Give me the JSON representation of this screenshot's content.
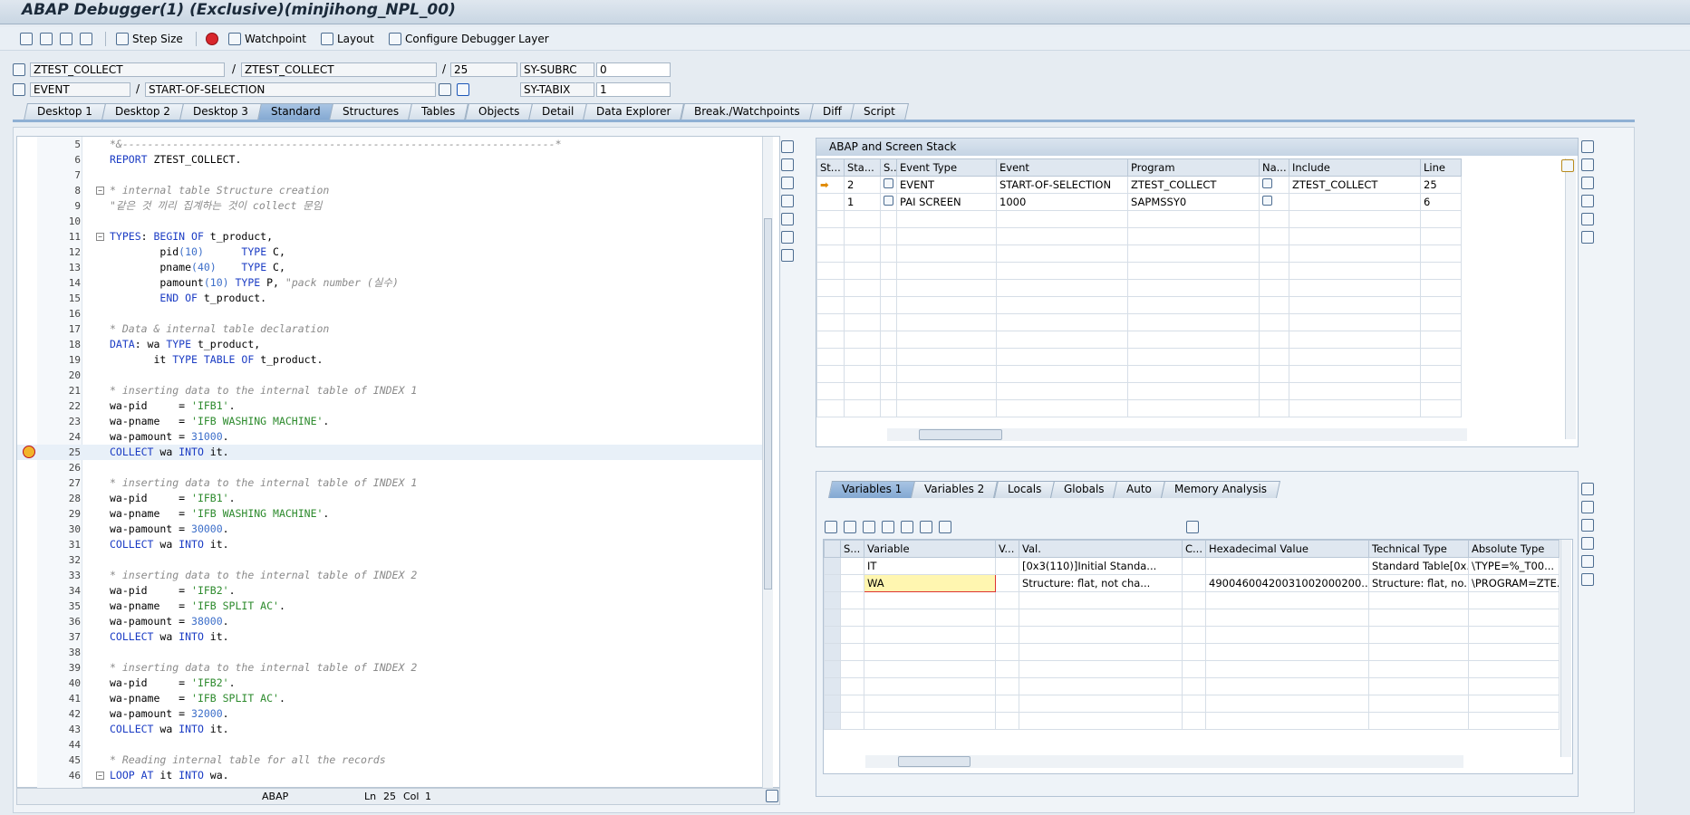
{
  "window": {
    "title": "ABAP Debugger(1)  (Exclusive)(minjihong_NPL_00)"
  },
  "toolbar": {
    "step_size": "Step Size",
    "watchpoint": "Watchpoint",
    "layout": "Layout",
    "configure": "Configure Debugger Layer"
  },
  "info": {
    "program": "ZTEST_COLLECT",
    "include": "ZTEST_COLLECT",
    "line": "25",
    "sy_subrc_label": "SY-SUBRC",
    "sy_subrc_value": "0",
    "event_type": "EVENT",
    "event": "START-OF-SELECTION",
    "sy_tabix_label": "SY-TABIX",
    "sy_tabix_value": "1"
  },
  "tabs": [
    "Desktop 1",
    "Desktop 2",
    "Desktop 3",
    "Standard",
    "Structures",
    "Tables",
    "Objects",
    "Detail",
    "Data Explorer",
    "Break./Watchpoints",
    "Diff",
    "Script"
  ],
  "editor": {
    "lines": [
      {
        "n": "5",
        "html": "<span class=\"c\">*&amp;---------------------------------------------------------------------*</span>"
      },
      {
        "n": "6",
        "html": "<span class=\"k\">REPORT</span> ZTEST_COLLECT."
      },
      {
        "n": "7",
        "html": ""
      },
      {
        "n": "8",
        "html": "<span class=\"c\">* internal table Structure creation</span>"
      },
      {
        "n": "9",
        "html": "<span class=\"c\">\"같은 것 끼리 집계하는 것이 collect 문임</span>"
      },
      {
        "n": "10",
        "html": ""
      },
      {
        "n": "11",
        "html": "<span class=\"k\">TYPES</span>: <span class=\"k\">BEGIN OF</span> t_product,"
      },
      {
        "n": "12",
        "html": "        pid<span class=\"num\">(10)</span>      <span class=\"k\">TYPE</span> C,"
      },
      {
        "n": "13",
        "html": "        pname<span class=\"num\">(40)</span>    <span class=\"k\">TYPE</span> C,"
      },
      {
        "n": "14",
        "html": "        pamount<span class=\"num\">(10)</span> <span class=\"k\">TYPE</span> P, <span class=\"c\">\"pack number (실수)</span>"
      },
      {
        "n": "15",
        "html": "        <span class=\"k\">END OF</span> t_product."
      },
      {
        "n": "16",
        "html": ""
      },
      {
        "n": "17",
        "html": "<span class=\"c\">* Data &amp; internal table declaration</span>"
      },
      {
        "n": "18",
        "html": "<span class=\"k\">DATA</span>: wa <span class=\"k\">TYPE</span> t_product,"
      },
      {
        "n": "19",
        "html": "       it <span class=\"k\">TYPE TABLE OF</span> t_product."
      },
      {
        "n": "20",
        "html": ""
      },
      {
        "n": "21",
        "html": "<span class=\"c\">* inserting data to the internal table of INDEX 1</span>"
      },
      {
        "n": "22",
        "html": "wa-pid     = <span class=\"s\">'IFB1'</span>."
      },
      {
        "n": "23",
        "html": "wa-pname   = <span class=\"s\">'IFB WASHING MACHINE'</span>."
      },
      {
        "n": "24",
        "html": "wa-pamount = <span class=\"num\">31000</span>."
      },
      {
        "n": "25",
        "html": "<span class=\"k\">COLLECT</span> wa <span class=\"k\">INTO</span> it."
      },
      {
        "n": "26",
        "html": ""
      },
      {
        "n": "27",
        "html": "<span class=\"c\">* inserting data to the internal table of INDEX 1</span>"
      },
      {
        "n": "28",
        "html": "wa-pid     = <span class=\"s\">'IFB1'</span>."
      },
      {
        "n": "29",
        "html": "wa-pname   = <span class=\"s\">'IFB WASHING MACHINE'</span>."
      },
      {
        "n": "30",
        "html": "wa-pamount = <span class=\"num\">30000</span>."
      },
      {
        "n": "31",
        "html": "<span class=\"k\">COLLECT</span> wa <span class=\"k\">INTO</span> it."
      },
      {
        "n": "32",
        "html": ""
      },
      {
        "n": "33",
        "html": "<span class=\"c\">* inserting data to the internal table of INDEX 2</span>"
      },
      {
        "n": "34",
        "html": "wa-pid     = <span class=\"s\">'IFB2'</span>."
      },
      {
        "n": "35",
        "html": "wa-pname   = <span class=\"s\">'IFB SPLIT AC'</span>."
      },
      {
        "n": "36",
        "html": "wa-pamount = <span class=\"num\">38000</span>."
      },
      {
        "n": "37",
        "html": "<span class=\"k\">COLLECT</span> wa <span class=\"k\">INTO</span> it."
      },
      {
        "n": "38",
        "html": ""
      },
      {
        "n": "39",
        "html": "<span class=\"c\">* inserting data to the internal table of INDEX 2</span>"
      },
      {
        "n": "40",
        "html": "wa-pid     = <span class=\"s\">'IFB2'</span>."
      },
      {
        "n": "41",
        "html": "wa-pname   = <span class=\"s\">'IFB SPLIT AC'</span>."
      },
      {
        "n": "42",
        "html": "wa-pamount = <span class=\"num\">32000</span>."
      },
      {
        "n": "43",
        "html": "<span class=\"k\">COLLECT</span> wa <span class=\"k\">INTO</span> it."
      },
      {
        "n": "44",
        "html": ""
      },
      {
        "n": "45",
        "html": "<span class=\"c\">* Reading internal table for all the records</span>"
      },
      {
        "n": "46",
        "html": "<span class=\"k\">LOOP AT</span> it <span class=\"k\">INTO</span> wa."
      }
    ],
    "status": {
      "lang": "ABAP",
      "ln_label": "Ln",
      "ln": "25",
      "col_label": "Col",
      "col": "1"
    }
  },
  "stack": {
    "title": "ABAP and Screen Stack",
    "columns": [
      "St...",
      "Sta...",
      "S...",
      "Event Type",
      "Event",
      "Program",
      "Na...",
      "Include",
      "Line"
    ],
    "rows": [
      {
        "sta": "2",
        "event_type": "EVENT",
        "event": "START-OF-SELECTION",
        "program": "ZTEST_COLLECT",
        "include": "ZTEST_COLLECT",
        "line": "25",
        "current": true
      },
      {
        "sta": "1",
        "event_type": "PAI SCREEN",
        "event": "1000",
        "program": "SAPMSSY0",
        "include": "",
        "line": "6",
        "current": false
      }
    ]
  },
  "vartabs": [
    "Variables 1",
    "Variables 2",
    "Locals",
    "Globals",
    "Auto",
    "Memory Analysis"
  ],
  "vars": {
    "columns": [
      "S...",
      "Variable",
      "V...",
      "Val.",
      "C...",
      "Hexadecimal Value",
      "Technical Type",
      "Absolute Type"
    ],
    "rows": [
      {
        "var": "IT",
        "val": "[0x3(110)]Initial Standa...",
        "hex": "",
        "tech": "Standard Table[0x...",
        "abs": "\\TYPE=%_T00..."
      },
      {
        "var": "WA",
        "val": "Structure: flat, not cha...",
        "hex": "49004600420031002000200...",
        "tech": "Structure: flat, no...",
        "abs": "\\PROGRAM=ZTE..."
      }
    ]
  },
  "colors": {
    "accent": "#8fb0d4",
    "current_line": "#e8f0f8",
    "selected_cell": "#fff6b0"
  }
}
